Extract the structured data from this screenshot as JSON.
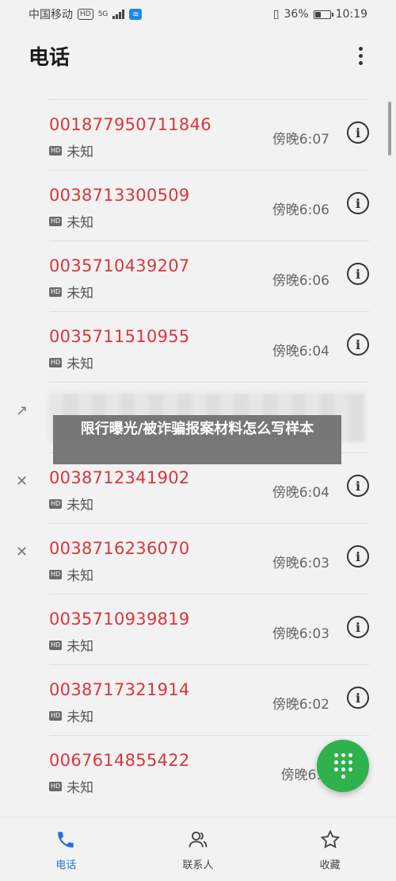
{
  "status": {
    "carrier": "中国移动",
    "hd_badge": "HD",
    "network": "5G",
    "battery": "36%",
    "battery_level": 0.36,
    "time": "10:19"
  },
  "header": {
    "title": "电话"
  },
  "calls": [
    {
      "number": "001877950711846",
      "label": "未知",
      "time": "傍晚6:07"
    },
    {
      "number": "0038713300509",
      "label": "未知",
      "time": "傍晚6:06"
    },
    {
      "number": "0035710439207",
      "label": "未知",
      "time": "傍晚6:06"
    },
    {
      "number": "0035711510955",
      "label": "未知",
      "time": "傍晚6:04"
    },
    {
      "number": "0038712341902",
      "label": "未知",
      "time": "傍晚6:04"
    },
    {
      "number": "0038716236070",
      "label": "未知",
      "time": "傍晚6:03"
    },
    {
      "number": "0035710939819",
      "label": "未知",
      "time": "傍晚6:03"
    },
    {
      "number": "0038717321914",
      "label": "未知",
      "time": "傍晚6:02"
    },
    {
      "number": "0067614855422",
      "label": "未知",
      "time": "傍晚6:0"
    }
  ],
  "call_icons": {
    "outgoing": "↗",
    "missed": "✕"
  },
  "banner": {
    "text": "限行曝光/被诈骗报案材料怎么写样本"
  },
  "nav": {
    "calls": "电话",
    "contacts": "联系人",
    "favorites": "收藏"
  },
  "colors": {
    "missed_number": "#d9363e",
    "accent": "#1e74d3",
    "fab": "#2fb24e"
  }
}
